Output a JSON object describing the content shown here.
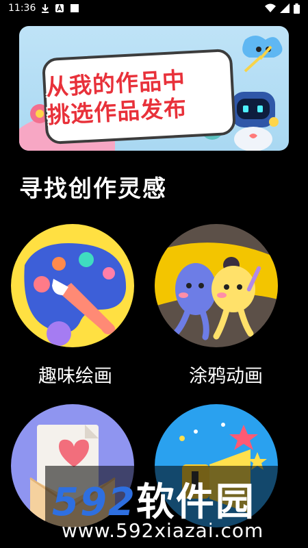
{
  "status_bar": {
    "time": "11:36",
    "icons": [
      "download-icon",
      "a-notification-icon",
      "square-notification-icon",
      "wifi-icon",
      "signal-icon",
      "battery-icon"
    ]
  },
  "banner": {
    "line1": "从我的作品中",
    "line2": "挑选作品发布"
  },
  "section": {
    "title": "寻找创作灵感"
  },
  "tiles": [
    {
      "label": "趣味绘画",
      "icon": "palette-icon"
    },
    {
      "label": "涂鸦动画",
      "icon": "cartoon-characters-icon"
    },
    {
      "label": "",
      "icon": "envelope-heart-icon"
    },
    {
      "label": "",
      "icon": "megaphone-icon"
    }
  ],
  "watermark": {
    "logo_digits": "592",
    "logo_text": "软件园",
    "url": "www.592xiazai.com"
  },
  "colors": {
    "background": "#000000",
    "banner_text": "#e8313a",
    "watermark_logo": "#2e6fe0"
  }
}
